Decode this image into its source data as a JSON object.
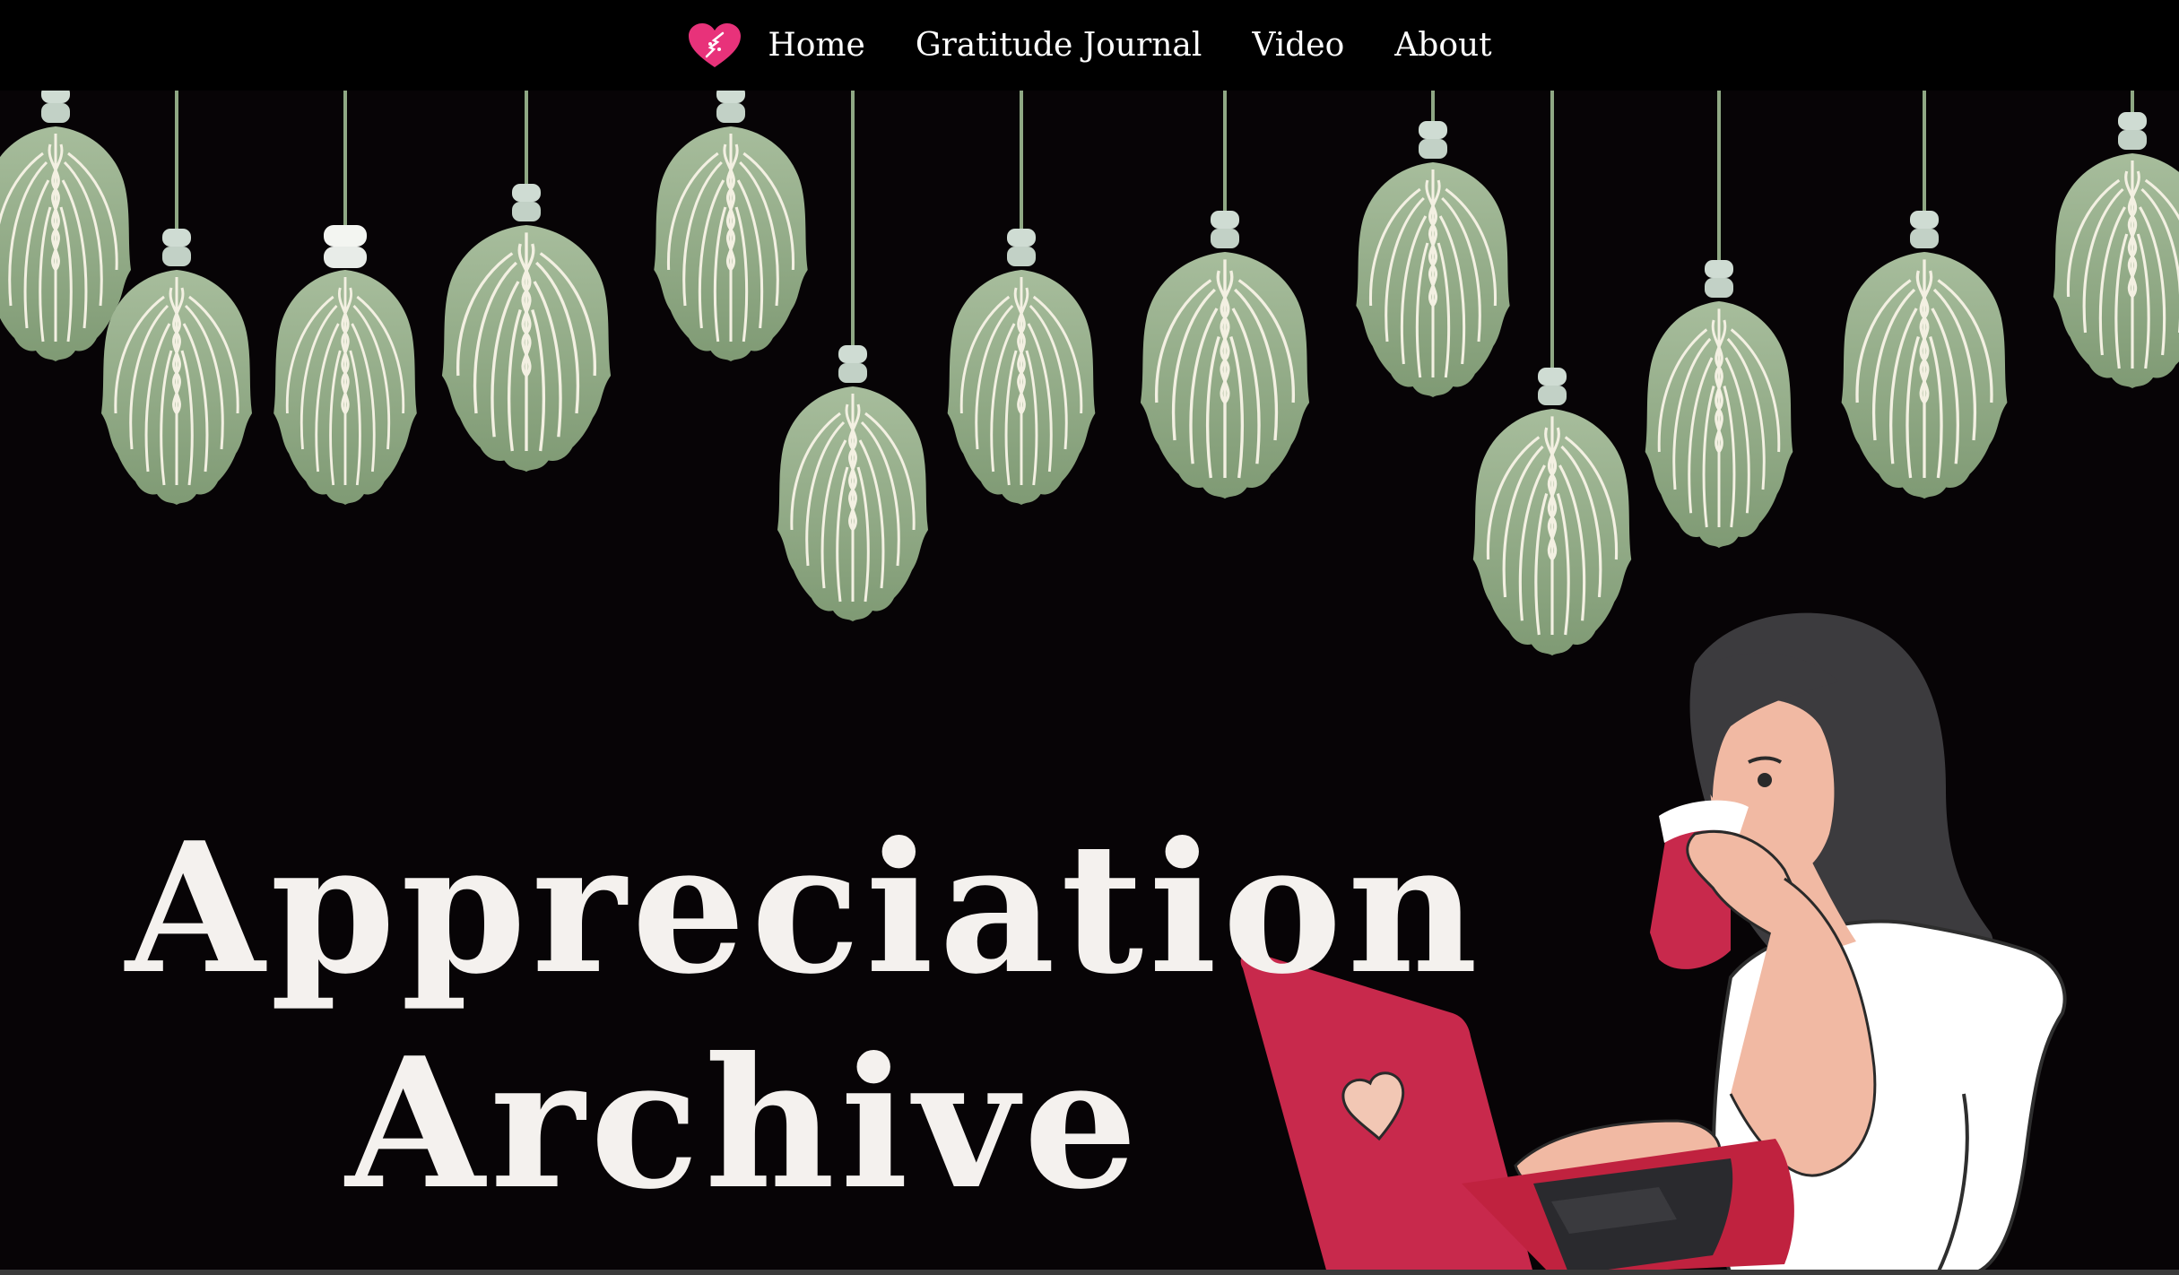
{
  "nav": {
    "logo_icon": "heart-logo-icon",
    "links": [
      {
        "label": "Home"
      },
      {
        "label": "Gratitude Journal"
      },
      {
        "label": "Video"
      },
      {
        "label": "About"
      }
    ]
  },
  "hero": {
    "title_line1": "Appreciation",
    "title_line2": "Archive"
  },
  "colors": {
    "background": "#070406",
    "navbar": "#000000",
    "leaf": "#8fa884",
    "leaf_vein": "#f3f0e2",
    "bead": "#c9d8cf",
    "accent": "#c8294c",
    "logo": "#e8327a",
    "text": "#f4f1ee"
  },
  "icons": [
    "heart-logo-icon",
    "hanging-leaf-decoration",
    "woman-with-laptop-illustration"
  ]
}
